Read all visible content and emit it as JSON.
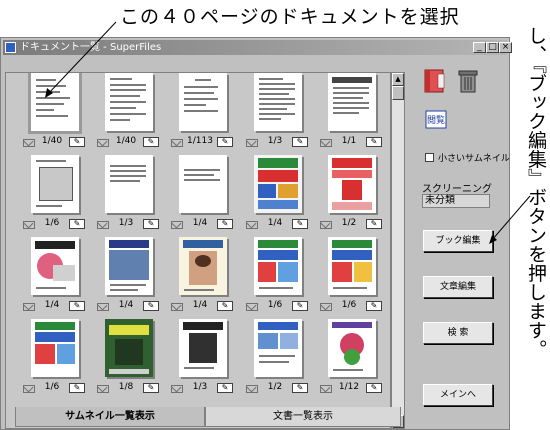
{
  "annotation": {
    "top": "この４０ページのドキュメントを選択",
    "right": "し、『ブック編集』ボタンを押します。"
  },
  "window": {
    "title": "ドキュメント一覧 - SuperFiles",
    "controls": [
      "_",
      "□",
      "×"
    ]
  },
  "thumbnails": [
    {
      "pages": "1/40",
      "selected": true
    },
    {
      "pages": "1/40"
    },
    {
      "pages": "1/113"
    },
    {
      "pages": "1/3"
    },
    {
      "pages": "1/1"
    },
    {
      "pages": "1/6"
    },
    {
      "pages": "1/3"
    },
    {
      "pages": "1/4"
    },
    {
      "pages": "1/4"
    },
    {
      "pages": "1/2"
    },
    {
      "pages": "1/4"
    },
    {
      "pages": "1/4"
    },
    {
      "pages": "1/4"
    },
    {
      "pages": "1/6"
    },
    {
      "pages": "1/6"
    },
    {
      "pages": "1/6"
    },
    {
      "pages": "1/8"
    },
    {
      "pages": "1/3"
    },
    {
      "pages": "1/2"
    },
    {
      "pages": "1/12"
    }
  ],
  "scrollbar": {
    "up": "▲",
    "down": "▼"
  },
  "tabs": [
    "サムネイル一覧表示",
    "文書一覧表示"
  ],
  "side": {
    "view_icon_label": "閲覧",
    "small_thumb_label": "小さいサムネイル",
    "screening_label": "スクリーニング",
    "screening_value": "未分類",
    "book_edit_button": "ブック編集",
    "text_edit_button": "文章編集",
    "search_button": "検 索",
    "main_button": "メインへ"
  },
  "colors": {
    "accent_red": "#d82020",
    "title_bar": "#7b7b7b",
    "book_icon": "#e05050"
  }
}
